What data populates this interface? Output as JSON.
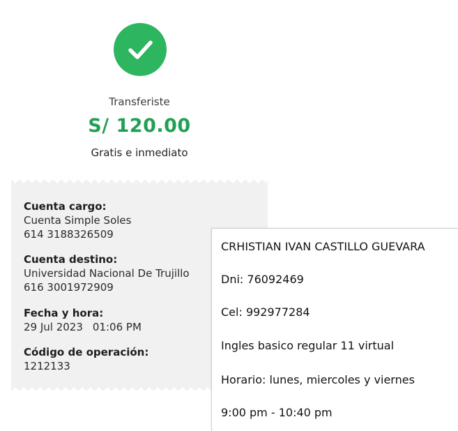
{
  "confirmation": {
    "icon": "check-icon",
    "label": "Transferiste",
    "amount": "S/ 120.00",
    "subtitle": "Gratis e inmediato",
    "accent_color": "#2db55f"
  },
  "details": {
    "cuenta_cargo": {
      "label": "Cuenta cargo:",
      "name": "Cuenta Simple Soles",
      "number": "614 3188326509"
    },
    "cuenta_destino": {
      "label": "Cuenta destino:",
      "name": "Universidad Nacional De Trujillo",
      "number": "616 3001972909"
    },
    "fecha_hora": {
      "label": "Fecha y hora:",
      "date": "29 Jul 2023",
      "time": "01:06 PM"
    },
    "codigo": {
      "label": "Código de operación:",
      "value": "1212133"
    }
  },
  "note": {
    "lines": [
      "CRHISTIAN IVAN CASTILLO GUEVARA",
      "Dni: 76092469",
      "Cel: 992977284",
      "Ingles basico regular 11 virtual",
      "Horario: lunes, miercoles y viernes",
      "9:00 pm - 10:40 pm"
    ]
  }
}
